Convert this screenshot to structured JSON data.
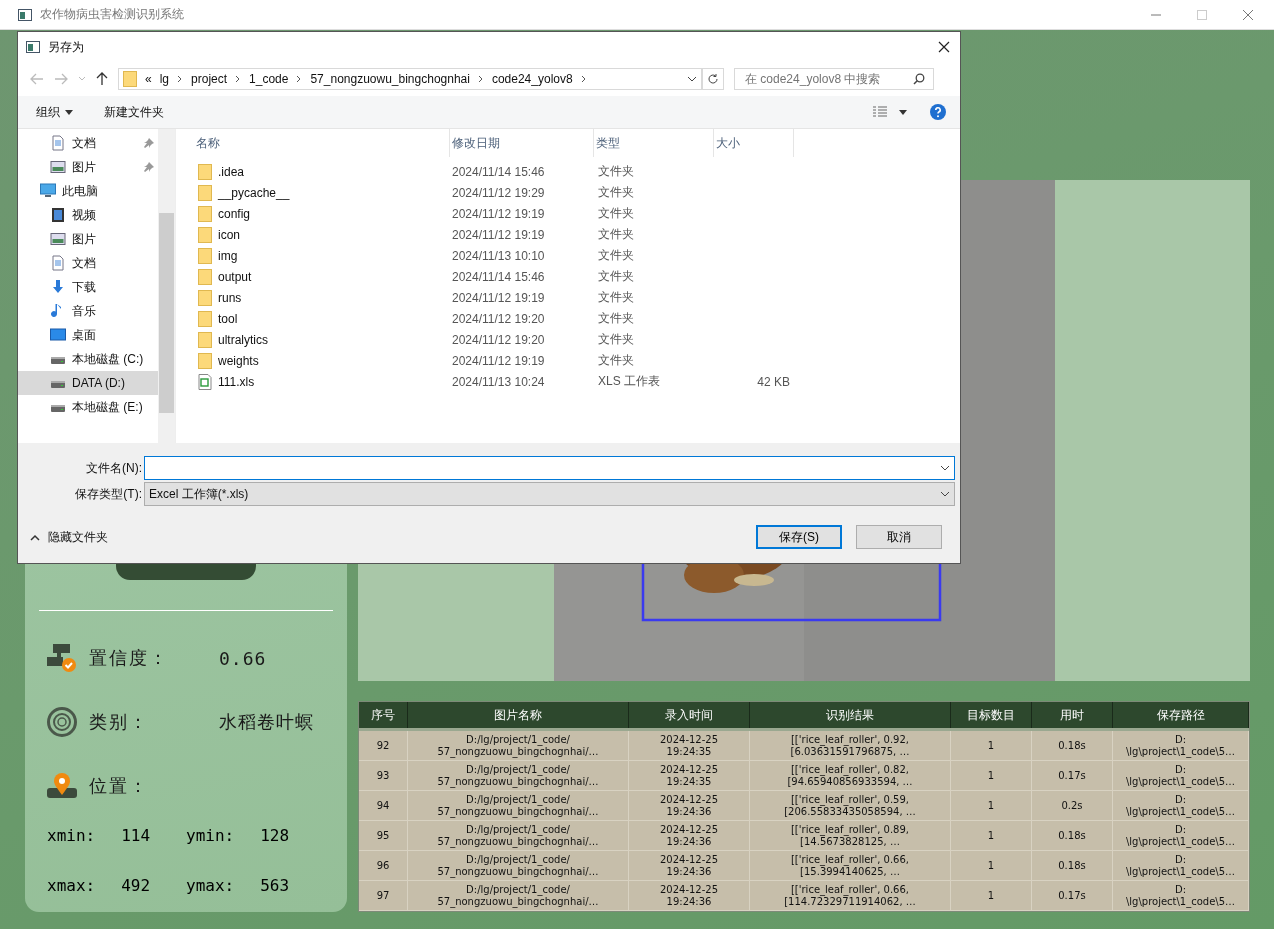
{
  "app": {
    "title": "农作物病虫害检测识别系统"
  },
  "info": {
    "confidence_label": "置信度：",
    "confidence": "0.66",
    "class_label": "类别：",
    "class": "水稻卷叶螟",
    "position_label": "位置：",
    "coords": [
      {
        "label": "xmin:",
        "value": "114"
      },
      {
        "label": "ymin:",
        "value": "128"
      },
      {
        "label": "xmax:",
        "value": "492"
      },
      {
        "label": "ymax:",
        "value": "563"
      }
    ]
  },
  "table": {
    "columns": [
      "序号",
      "图片名称",
      "录入时间",
      "识别结果",
      "目标数目",
      "用时",
      "保存路径"
    ],
    "rows": [
      [
        "92",
        "D:/lg/project/1_code/\n57_nongzuowu_bingchognhai/…",
        "2024-12-25\n19:24:35",
        "[['rice_leaf_roller', 0.92,\n[6.03631591796875, …",
        "1",
        "0.18s",
        "D:\n\\lg\\project\\1_code\\5…"
      ],
      [
        "93",
        "D:/lg/project/1_code/\n57_nongzuowu_bingchognhai/…",
        "2024-12-25\n19:24:35",
        "[['rice_leaf_roller', 0.82,\n[94.65940856933594, …",
        "1",
        "0.17s",
        "D:\n\\lg\\project\\1_code\\5…"
      ],
      [
        "94",
        "D:/lg/project/1_code/\n57_nongzuowu_bingchognhai/…",
        "2024-12-25\n19:24:36",
        "[['rice_leaf_roller', 0.59,\n[206.55833435058594, …",
        "1",
        "0.2s",
        "D:\n\\lg\\project\\1_code\\5…"
      ],
      [
        "95",
        "D:/lg/project/1_code/\n57_nongzuowu_bingchognhai/…",
        "2024-12-25\n19:24:36",
        "[['rice_leaf_roller', 0.89,\n[14.5673828125, …",
        "1",
        "0.18s",
        "D:\n\\lg\\project\\1_code\\5…"
      ],
      [
        "96",
        "D:/lg/project/1_code/\n57_nongzuowu_bingchognhai/…",
        "2024-12-25\n19:24:36",
        "[['rice_leaf_roller', 0.66,\n[15.3994140625, …",
        "1",
        "0.18s",
        "D:\n\\lg\\project\\1_code\\5…"
      ],
      [
        "97",
        "D:/lg/project/1_code/\n57_nongzuowu_bingchognhai/…",
        "2024-12-25\n19:24:36",
        "[['rice_leaf_roller', 0.66,\n[114.72329711914062, …",
        "1",
        "0.17s",
        "D:\n\\lg\\project\\1_code\\5…"
      ]
    ]
  },
  "dialog": {
    "title": "另存为",
    "crumbs": [
      "«",
      "lg",
      "project",
      "1_code",
      "57_nongzuowu_bingchognhai",
      "code24_yolov8"
    ],
    "search": {
      "placeholder": "在 code24_yolov8 中搜索"
    },
    "toolbar": {
      "organize": "组织",
      "new_folder": "新建文件夹"
    },
    "nav": [
      {
        "label": "文档",
        "kind": "doc",
        "pinned": true,
        "selected": false
      },
      {
        "label": "图片",
        "kind": "pic",
        "pinned": true,
        "selected": false
      },
      {
        "label": "此电脑",
        "kind": "pc",
        "pinned": false,
        "selected": false,
        "children": [
          {
            "label": "视频",
            "kind": "video",
            "pinned": false,
            "selected": false
          },
          {
            "label": "图片",
            "kind": "pic",
            "pinned": false,
            "selected": false
          },
          {
            "label": "文档",
            "kind": "doc",
            "pinned": false,
            "selected": false
          },
          {
            "label": "下载",
            "kind": "download",
            "pinned": false,
            "selected": false
          },
          {
            "label": "音乐",
            "kind": "music",
            "pinned": false,
            "selected": false
          },
          {
            "label": "桌面",
            "kind": "desktop",
            "pinned": false,
            "selected": false
          },
          {
            "label": "本地磁盘 (C:)",
            "kind": "disk",
            "pinned": false,
            "selected": false
          },
          {
            "label": "DATA (D:)",
            "kind": "disk",
            "pinned": false,
            "selected": true
          },
          {
            "label": "本地磁盘 (E:)",
            "kind": "disk",
            "pinned": false,
            "selected": false
          }
        ]
      }
    ],
    "columns": [
      "名称",
      "修改日期",
      "类型",
      "大小"
    ],
    "files": [
      {
        "name": ".idea",
        "date": "2024/11/14 15:46",
        "type": "文件夹",
        "kind": "folder"
      },
      {
        "name": "__pycache__",
        "date": "2024/11/12 19:29",
        "type": "文件夹",
        "kind": "folder"
      },
      {
        "name": "config",
        "date": "2024/11/12 19:19",
        "type": "文件夹",
        "kind": "folder"
      },
      {
        "name": "icon",
        "date": "2024/11/12 19:19",
        "type": "文件夹",
        "kind": "folder"
      },
      {
        "name": "img",
        "date": "2024/11/13 10:10",
        "type": "文件夹",
        "kind": "folder"
      },
      {
        "name": "output",
        "date": "2024/11/14 15:46",
        "type": "文件夹",
        "kind": "folder"
      },
      {
        "name": "runs",
        "date": "2024/11/12 19:19",
        "type": "文件夹",
        "kind": "folder"
      },
      {
        "name": "tool",
        "date": "2024/11/12 19:20",
        "type": "文件夹",
        "kind": "folder"
      },
      {
        "name": "ultralytics",
        "date": "2024/11/12 19:20",
        "type": "文件夹",
        "kind": "folder"
      },
      {
        "name": "weights",
        "date": "2024/11/12 19:19",
        "type": "文件夹",
        "kind": "folder"
      },
      {
        "name": "111.xls",
        "date": "2024/11/13 10:24",
        "type": "XLS 工作表",
        "size": "42 KB",
        "kind": "sheet"
      }
    ],
    "filename_label": "文件名(N):",
    "filetype_label": "保存类型(T):",
    "filetype": "Excel 工作簿(*.xls)",
    "hide_folders": "隐藏文件夹",
    "save": "保存(S)",
    "cancel": "取消"
  }
}
